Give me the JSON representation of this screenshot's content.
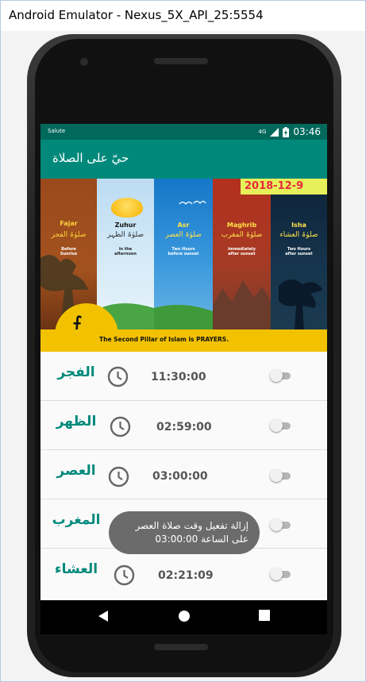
{
  "window": {
    "title": "Android Emulator - Nexus_5X_API_25:5554"
  },
  "status_bar": {
    "left_text": "Salute",
    "network": "4G",
    "time": "03:46",
    "icons": [
      "signal-icon",
      "battery-icon"
    ]
  },
  "app_bar": {
    "title": "حيّ على الصلاة"
  },
  "banner": {
    "date": "2018-12-9",
    "footer_text": "The Second Pillar of Islam is PRAYERS.",
    "prayers": [
      {
        "name": "Fajar",
        "arabic": "صلوٰۃ الفجر",
        "note_1": "Before",
        "note_2": "Sunrise"
      },
      {
        "name": "Zuhur",
        "arabic": "صلوٰۃ الظہر",
        "note_1": "in the",
        "note_2": "afternoon"
      },
      {
        "name": "Asr",
        "arabic": "صلوٰۃ العصر",
        "note_1": "Two Hours",
        "note_2": "before sunset"
      },
      {
        "name": "Maghrib",
        "arabic": "صلوٰۃ المغرب",
        "note_1": "immediately",
        "note_2": "after sunset"
      },
      {
        "name": "Isha",
        "arabic": "صلوٰۃ العشاء",
        "note_1": "Two Hours",
        "note_2": "after sunset"
      }
    ]
  },
  "prayer_list": [
    {
      "name": "الفجر",
      "time": "11:30:00",
      "enabled": false
    },
    {
      "name": "الظهر",
      "time": "02:59:00",
      "enabled": false
    },
    {
      "name": "العصر",
      "time": "03:00:00",
      "enabled": false
    },
    {
      "name": "المغرب",
      "time": "",
      "enabled": false
    },
    {
      "name": "العشاء",
      "time": "02:21:09",
      "enabled": false
    }
  ],
  "toast": {
    "line_1": "إزالة تفعيل وقت صلاة العصر",
    "line_2": "على الساعة 03:00:00"
  },
  "nav_bar": {
    "icons": [
      "back-icon",
      "home-icon",
      "recents-icon"
    ]
  },
  "colors": {
    "status_bar": "#00695c",
    "app_bar": "#00897b",
    "accent_text": "#00897b",
    "date_text": "#e8283e",
    "date_bg": "#e6f05a",
    "banner_footer": "#f2c200"
  }
}
